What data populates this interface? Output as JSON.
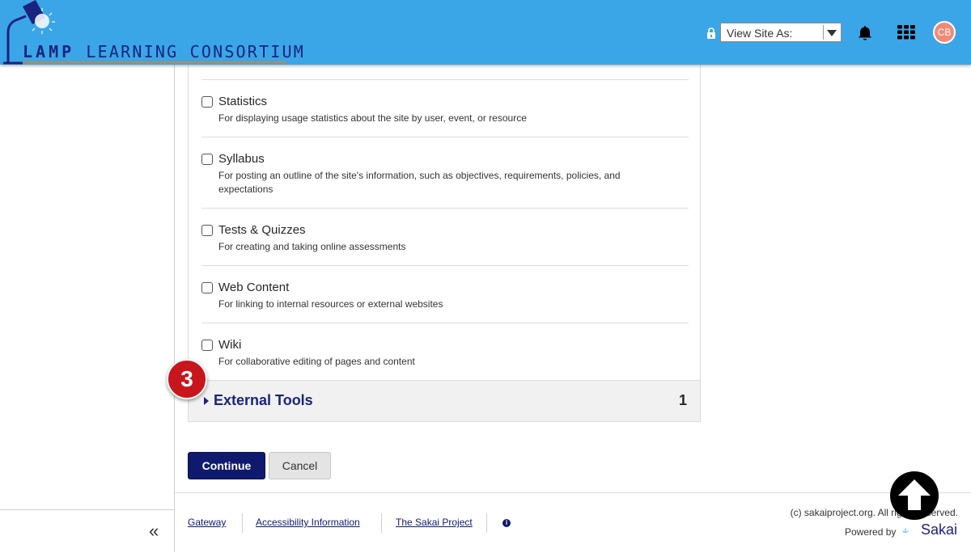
{
  "header": {
    "logo_word1": "LAMP",
    "logo_word2": "LEARNING CONSORTIUM",
    "view_site_as": {
      "label": "View Site As:"
    },
    "avatar_initials": "CB",
    "colors": {
      "bar": "#3aa6e8",
      "logo_text": "#1a237e",
      "logo_underline": "#d9822b"
    }
  },
  "tools": [
    {
      "name": "Statistics",
      "description": "For displaying usage statistics about the site by user, event, or resource",
      "checked": false
    },
    {
      "name": "Syllabus",
      "description": "For posting an outline of the site's information, such as objectives, requirements, policies, and expectations",
      "checked": false
    },
    {
      "name": "Tests & Quizzes",
      "description": "For creating and taking online assessments",
      "checked": false
    },
    {
      "name": "Web Content",
      "description": "For linking to internal resources or external websites",
      "checked": false
    },
    {
      "name": "Wiki",
      "description": "For collaborative editing of pages and content",
      "checked": false
    }
  ],
  "external_tools": {
    "title": "External Tools",
    "count": "1"
  },
  "step_badge": "3",
  "buttons": {
    "continue": "Continue",
    "cancel": "Cancel"
  },
  "footer": {
    "links": [
      "Gateway",
      "Accessibility Information",
      "The Sakai Project"
    ],
    "copyright": "(c) sakaiproject.org. All rights reserved.",
    "powered_by": "Powered by",
    "sakai_word": "Sakai"
  },
  "icons": [
    "lamp-logo-icon",
    "lock-icon",
    "bell-icon",
    "apps-grid-icon",
    "info-icon",
    "collapse-double-chevron-icon",
    "scroll-to-top-arrow-icon",
    "sakai-wave-icon"
  ]
}
